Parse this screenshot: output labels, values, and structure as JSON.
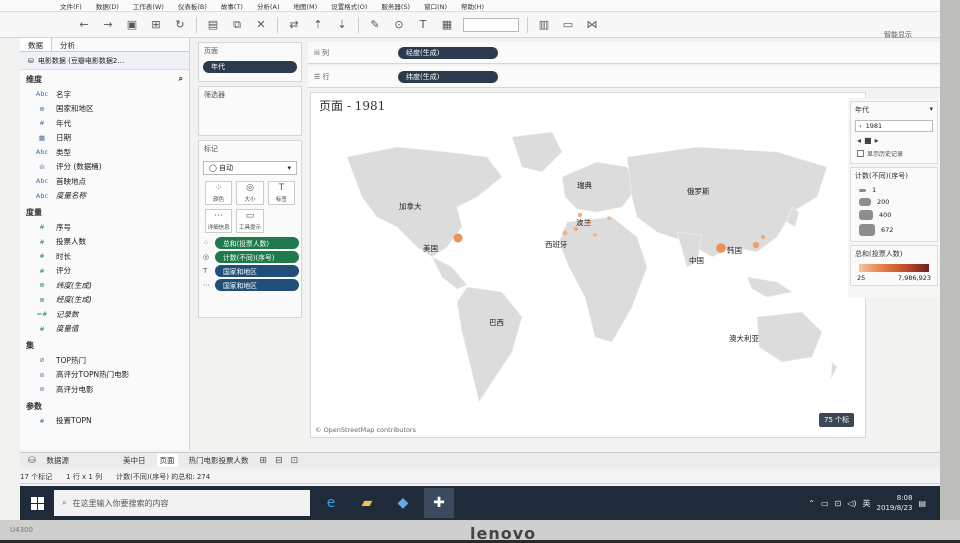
{
  "menubar": [
    "文件(F)",
    "数据(D)",
    "工作表(W)",
    "仪表板(B)",
    "故事(T)",
    "分析(A)",
    "地图(M)",
    "设置格式(O)",
    "服务器(S)",
    "窗口(N)",
    "帮助(H)"
  ],
  "show_me": "智能显示",
  "datapane": {
    "tabs": [
      "数据",
      "分析"
    ],
    "datasource": "电影数据 (豆瓣电影数据2…",
    "dimensions_title": "维度",
    "dimensions": [
      {
        "icon": "Abc",
        "label": "名字"
      },
      {
        "icon": "⊕",
        "label": "国家和地区"
      },
      {
        "icon": "#",
        "label": "年代"
      },
      {
        "icon": "▦",
        "label": "日期"
      },
      {
        "icon": "Abc",
        "label": "类型"
      },
      {
        "icon": "ılı",
        "label": "评分 (数据桶)"
      },
      {
        "icon": "Abc",
        "label": "首映地点"
      },
      {
        "icon": "Abc",
        "label": "度量名称",
        "italic": true
      }
    ],
    "measures_title": "度量",
    "measures": [
      {
        "icon": "#",
        "label": "序号"
      },
      {
        "icon": "#",
        "label": "投票人数"
      },
      {
        "icon": "#",
        "label": "时长"
      },
      {
        "icon": "#",
        "label": "评分"
      },
      {
        "icon": "⊕",
        "label": "纬度(生成)",
        "italic": true
      },
      {
        "icon": "⊕",
        "label": "经度(生成)",
        "italic": true
      },
      {
        "icon": "=#",
        "label": "记录数",
        "italic": true
      },
      {
        "icon": "#",
        "label": "度量值",
        "italic": true
      }
    ],
    "sets_title": "集",
    "sets": [
      {
        "icon": "⊘",
        "label": "TOP热门"
      },
      {
        "icon": "⊘",
        "label": "高评分TOPN热门电影"
      },
      {
        "icon": "⊘",
        "label": "高评分电影"
      }
    ],
    "params_title": "参数",
    "params": [
      {
        "icon": "#",
        "label": "投置TOPN"
      }
    ]
  },
  "cards": {
    "pages_title": "页面",
    "pages_pill": "年代",
    "filters_title": "筛选器",
    "marks_title": "标记",
    "mark_type": "◯ 自动",
    "mark_buttons": [
      {
        "glyph": "⁘",
        "label": "颜色"
      },
      {
        "glyph": "◎",
        "label": "大小"
      },
      {
        "glyph": "T",
        "label": "标签"
      },
      {
        "glyph": "⋯",
        "label": "详细信息"
      },
      {
        "glyph": "▭",
        "label": "工具提示"
      }
    ],
    "encodings": [
      {
        "icon": "⁘",
        "label": "总和(投票人数)",
        "color": "green"
      },
      {
        "icon": "◎",
        "label": "计数(不同)(序号)",
        "color": "green"
      },
      {
        "icon": "T",
        "label": "国家和地区",
        "color": "blue"
      },
      {
        "icon": "⋯",
        "label": "国家和地区",
        "color": "blue"
      }
    ]
  },
  "shelves": {
    "columns_label": "iii 列",
    "columns_pill": "经度(生成)",
    "rows_label": "☰ 行",
    "rows_pill": "纬度(生成)"
  },
  "view": {
    "title": "页面 - 1981",
    "labels": [
      {
        "text": "加拿大"
      },
      {
        "text": "美国"
      },
      {
        "text": "瑞典"
      },
      {
        "text": "俄罗斯"
      },
      {
        "text": "波兰"
      },
      {
        "text": "西班牙"
      },
      {
        "text": "中国"
      },
      {
        "text": "韩国"
      },
      {
        "text": "巴西"
      },
      {
        "text": "澳大利亚"
      }
    ],
    "attribution": "© OpenStreetMap contributors",
    "badge": "75 个标"
  },
  "sidepanel": {
    "page_title": "年代",
    "page_value": "1981",
    "history_label": "显示历史记录",
    "size_title": "计数(不同)(序号)",
    "size_items": [
      "1",
      "200",
      "400",
      "672"
    ],
    "color_title": "总和(投票人数)",
    "color_min": "25",
    "color_max": "7,986,923"
  },
  "sheettabs": {
    "datasource": "数据源",
    "tabs": [
      "美中日",
      "页面",
      "热门电影投票人数"
    ]
  },
  "status": [
    "17 个标记",
    "1 行 x 1 列",
    "计数(不同)(序号) 的总和: 274"
  ],
  "taskbar": {
    "search_placeholder": "在这里输入你要搜索的内容",
    "ime": "英",
    "time": "8:08",
    "date": "2019/8/23"
  },
  "bezel": {
    "brand": "lenovo",
    "model": "U4300"
  },
  "colors": {
    "accent_blue": "#1f4e79",
    "accent_green": "#1e7a4a",
    "mark_orange": "#e8894a"
  }
}
